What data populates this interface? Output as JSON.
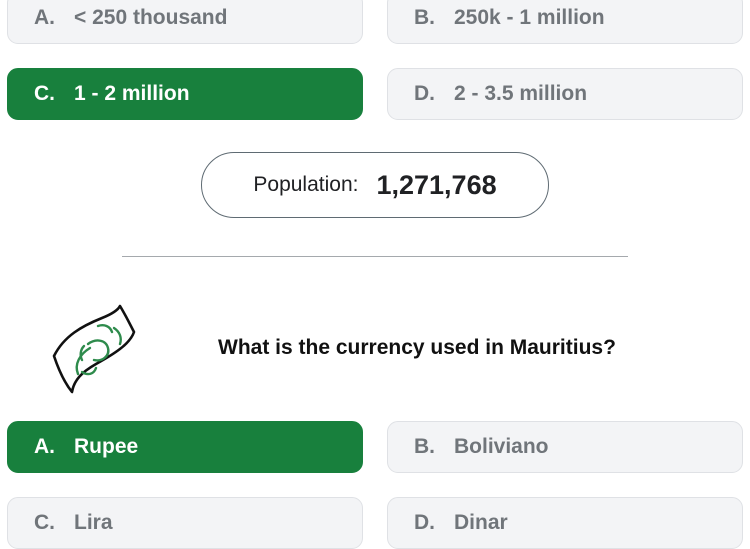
{
  "population_question": {
    "options": [
      {
        "letter": "A.",
        "text": "< 250 thousand",
        "state": "neutral"
      },
      {
        "letter": "B.",
        "text": "250k - 1 million",
        "state": "neutral"
      },
      {
        "letter": "C.",
        "text": "1 - 2 million",
        "state": "correct"
      },
      {
        "letter": "D.",
        "text": "2 - 3.5 million",
        "state": "neutral"
      }
    ],
    "result_label": "Population:",
    "result_value": "1,271,768"
  },
  "currency_question": {
    "icon": "banknote-icon",
    "question": "What is the currency used in Mauritius?",
    "options": [
      {
        "letter": "A.",
        "text": "Rupee",
        "state": "correct"
      },
      {
        "letter": "B.",
        "text": "Boliviano",
        "state": "neutral"
      },
      {
        "letter": "C.",
        "text": "Lira",
        "state": "neutral"
      },
      {
        "letter": "D.",
        "text": "Dinar",
        "state": "neutral"
      }
    ]
  },
  "colors": {
    "correct": "#18803d",
    "neutral_bg": "#f3f4f6",
    "neutral_text": "#70757a"
  }
}
